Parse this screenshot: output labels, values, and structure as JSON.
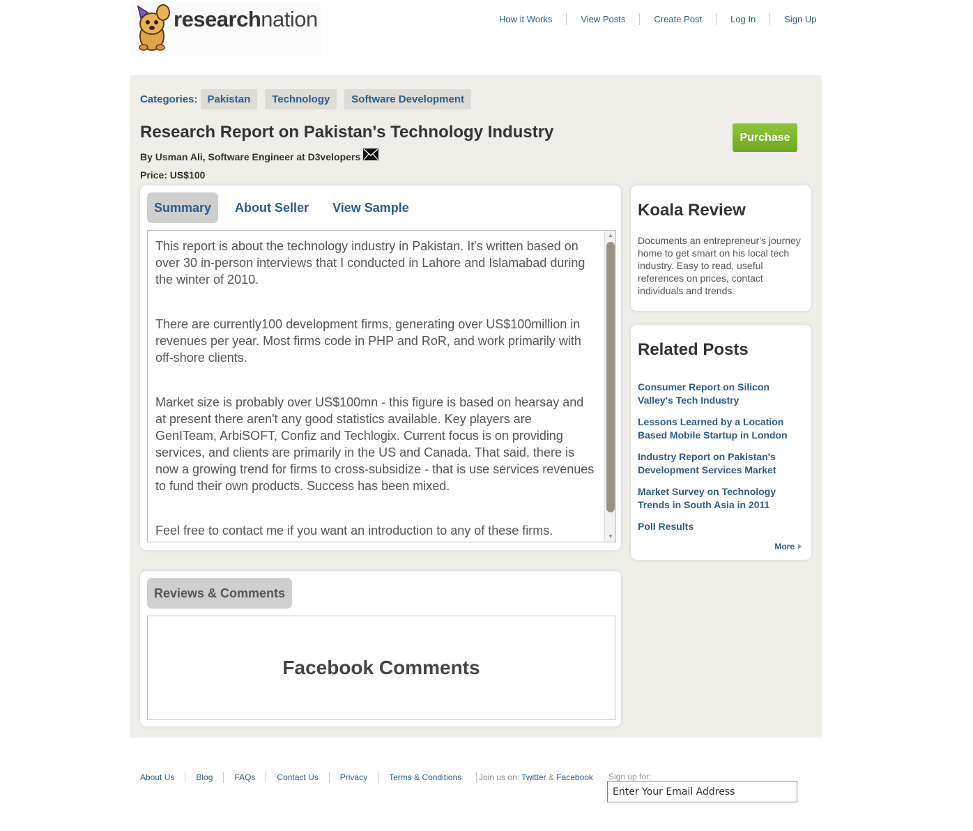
{
  "header": {
    "logo_bold": "research",
    "logo_light": "nation",
    "nav": [
      "How it Works",
      "View Posts",
      "Create Post",
      "Log In",
      "Sign Up"
    ]
  },
  "post": {
    "categories_label": "Categories:",
    "categories": [
      "Pakistan",
      "Technology",
      "Software Development"
    ],
    "title": "Research Report on Pakistan's Technology Industry",
    "byline": "By Usman Ali, Software Engineer at D3velopers",
    "price": "Price: US$100",
    "purchase_label": "Purchase"
  },
  "tabs": [
    "Summary",
    "About Seller",
    "View Sample"
  ],
  "summary_paragraphs": [
    "This report is about the technology industry in Pakistan. It's written based on over 30 in-person interviews that I conducted in Lahore and Islamabad during the winter of 2010.",
    "There are currently100 development firms, generating over US$100million in revenues per year. Most firms code in PHP and RoR, and work primarily with off-shore clients.",
    "Market size is probably over US$100mn - this figure is based on hearsay and at present there aren't any good statistics available. Key players are GenITeam, ArbiSOFT, Confiz and Techlogix. Current focus is on providing services, and clients are primarily in the US and Canada. That said, there is now a growing trend for firms to cross-subsidize - that is use services revenues to fund their own products. Success has been mixed.",
    "Feel free to contact me if you want an introduction to any of these firms."
  ],
  "reviews": {
    "tab_label": "Reviews & Comments",
    "placeholder": "Facebook Comments"
  },
  "koala": {
    "title": "Koala Review",
    "text": "Documents an entrepreneur's journey home to get smart on his local tech industry. Easy to read, useful references on prices, contact individuals and trends"
  },
  "related": {
    "title": "Related Posts",
    "items": [
      "Consumer Report on Silicon Valley's Tech Industry",
      "Lessons Learned by a Location Based Mobile Startup in London",
      "Industry Report on Pakistan's Development Services Market",
      "Market Survey on Technology Trends in South Asia in 2011",
      "Poll Results"
    ],
    "more_label": "More"
  },
  "footer": {
    "links": [
      "About Us",
      "Blog",
      "FAQs",
      "Contact Us",
      "Privacy",
      "Terms & Conditions"
    ],
    "join_text": "Join us on:",
    "twitter": "Twitter",
    "amp": "&",
    "facebook": "Facebook",
    "signup_label": "Sign up for:",
    "email_placeholder": "Enter Your Email Address"
  }
}
